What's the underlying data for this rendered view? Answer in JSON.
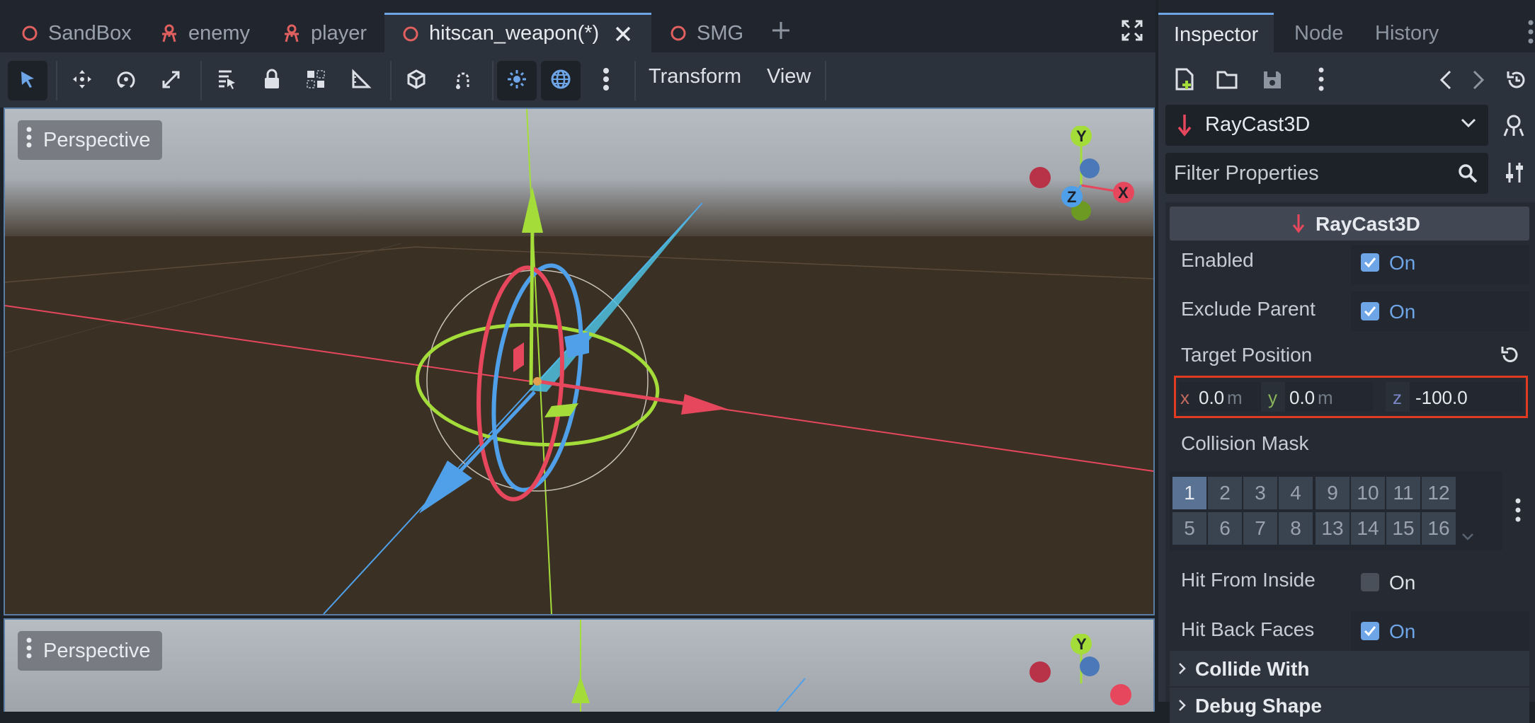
{
  "tabs": [
    {
      "label": "SandBox",
      "icon": "node3d-icon",
      "color": "#e0605f"
    },
    {
      "label": "enemy",
      "icon": "character-icon",
      "color": "#e0605f"
    },
    {
      "label": "player",
      "icon": "character-icon",
      "color": "#e0605f"
    },
    {
      "label": "hitscan_weapon(*)",
      "icon": "node3d-icon",
      "color": "#e0605f"
    },
    {
      "label": "SMG",
      "icon": "node3d-icon",
      "color": "#e0605f"
    }
  ],
  "toolbar": {
    "transform_label": "Transform",
    "view_label": "View"
  },
  "viewport_top": {
    "label": "Perspective"
  },
  "viewport_bottom": {
    "label": "Perspective"
  },
  "gizmo": {
    "y": "Y",
    "x": "X",
    "z": "Z"
  },
  "inspector": {
    "tabs": {
      "inspector": "Inspector",
      "node": "Node",
      "history": "History"
    },
    "node_type": "RayCast3D",
    "filter_placeholder": "Filter Properties",
    "section_title": "RayCast3D",
    "properties": {
      "enabled": {
        "label": "Enabled",
        "value": "On",
        "checked": true
      },
      "exclude_parent": {
        "label": "Exclude Parent",
        "value": "On",
        "checked": true
      },
      "target_position": {
        "label": "Target Position",
        "x_label": "x",
        "x": "0.0",
        "x_unit": "m",
        "y_label": "y",
        "y": "0.0",
        "y_unit": "m",
        "z_label": "z",
        "z": "-100.0"
      },
      "collision_mask": {
        "label": "Collision Mask",
        "layers": [
          "1",
          "2",
          "3",
          "4",
          "9",
          "10",
          "11",
          "12",
          "5",
          "6",
          "7",
          "8",
          "13",
          "14",
          "15",
          "16"
        ],
        "selected": [
          "1"
        ]
      },
      "hit_from_inside": {
        "label": "Hit From Inside",
        "value": "On",
        "checked": false
      },
      "hit_back_faces": {
        "label": "Hit Back Faces",
        "value": "On",
        "checked": true
      }
    },
    "groups": {
      "collide_with": "Collide With",
      "debug_shape": "Debug Shape"
    }
  },
  "colors": {
    "accent": "#6ea5e6",
    "x_axis": "#e6475c",
    "y_axis": "#a4dd3a",
    "z_axis": "#4fa0e8",
    "highlight": "#e03a20"
  }
}
